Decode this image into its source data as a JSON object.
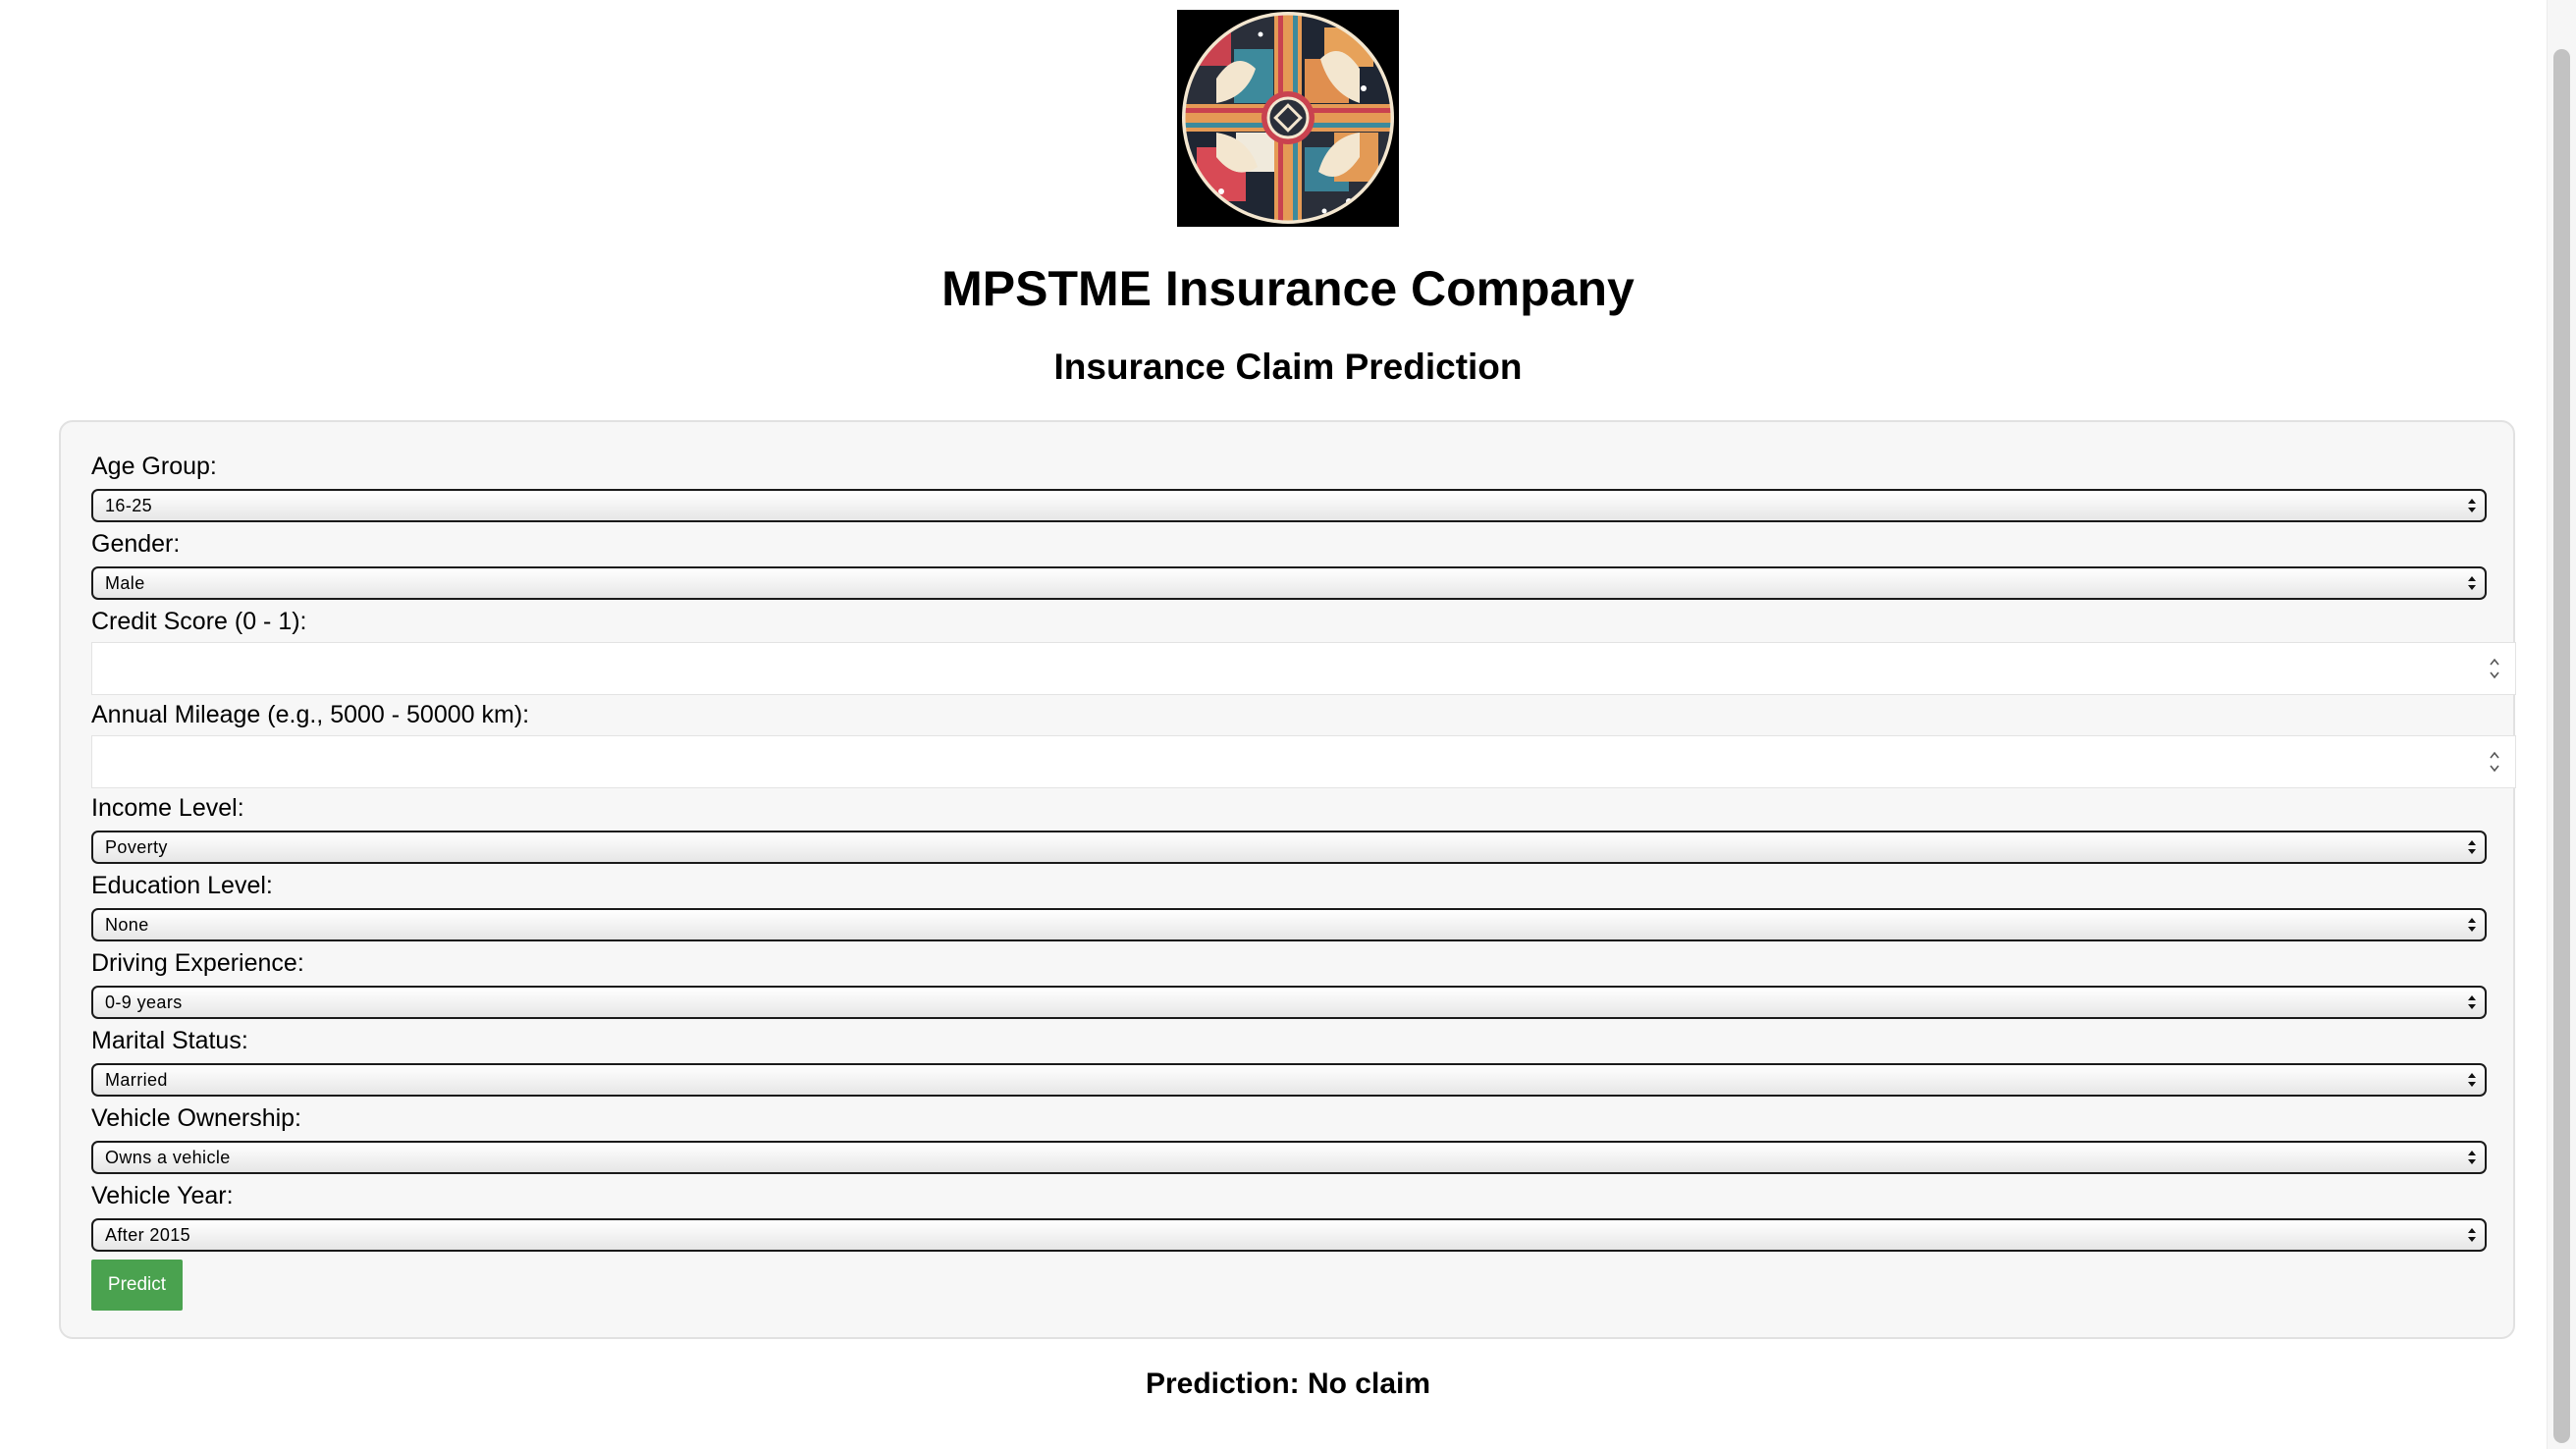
{
  "header": {
    "company_name": "MPSTME Insurance Company",
    "page_title": "Insurance Claim Prediction"
  },
  "form": {
    "age_group": {
      "label": "Age Group:",
      "value": "16-25"
    },
    "gender": {
      "label": "Gender:",
      "value": "Male"
    },
    "credit_score": {
      "label": "Credit Score (0 - 1):",
      "value": ""
    },
    "annual_mileage": {
      "label": "Annual Mileage (e.g., 5000 - 50000 km):",
      "value": ""
    },
    "income_level": {
      "label": "Income Level:",
      "value": "Poverty"
    },
    "education_level": {
      "label": "Education Level:",
      "value": "None"
    },
    "driving_experience": {
      "label": "Driving Experience:",
      "value": "0-9 years"
    },
    "marital_status": {
      "label": "Marital Status:",
      "value": "Married"
    },
    "vehicle_ownership": {
      "label": "Vehicle Ownership:",
      "value": "Owns a vehicle"
    },
    "vehicle_year": {
      "label": "Vehicle Year:",
      "value": "After 2015"
    },
    "predict_button_label": "Predict"
  },
  "result": {
    "text": "Prediction: No claim"
  },
  "colors": {
    "button_green": "#4aa24f",
    "card_background": "#f7f7f7",
    "card_border": "#e1e1e1"
  }
}
